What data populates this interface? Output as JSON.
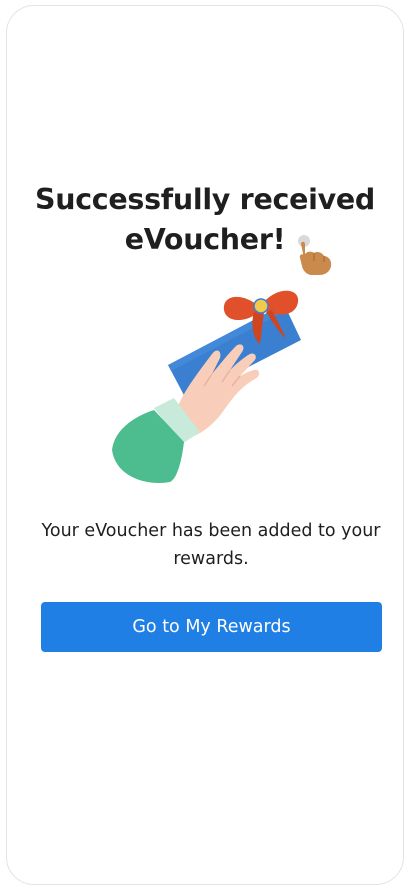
{
  "success": {
    "title_line1": "Successfully received",
    "title_line2": "eVoucher!",
    "message": "Your eVoucher has been added to your rewards.",
    "primary_button_label": "Go to My Rewards",
    "illustration_icon": "hand-holding-gift-voucher-icon",
    "tap_icon": "tap-hand-icon"
  },
  "colors": {
    "accent": "#1f7fe5",
    "voucher": "#3a7fd0",
    "ribbon": "#e0502a",
    "sleeve": "#4dbd8f",
    "skin": "#f8cdb9"
  }
}
